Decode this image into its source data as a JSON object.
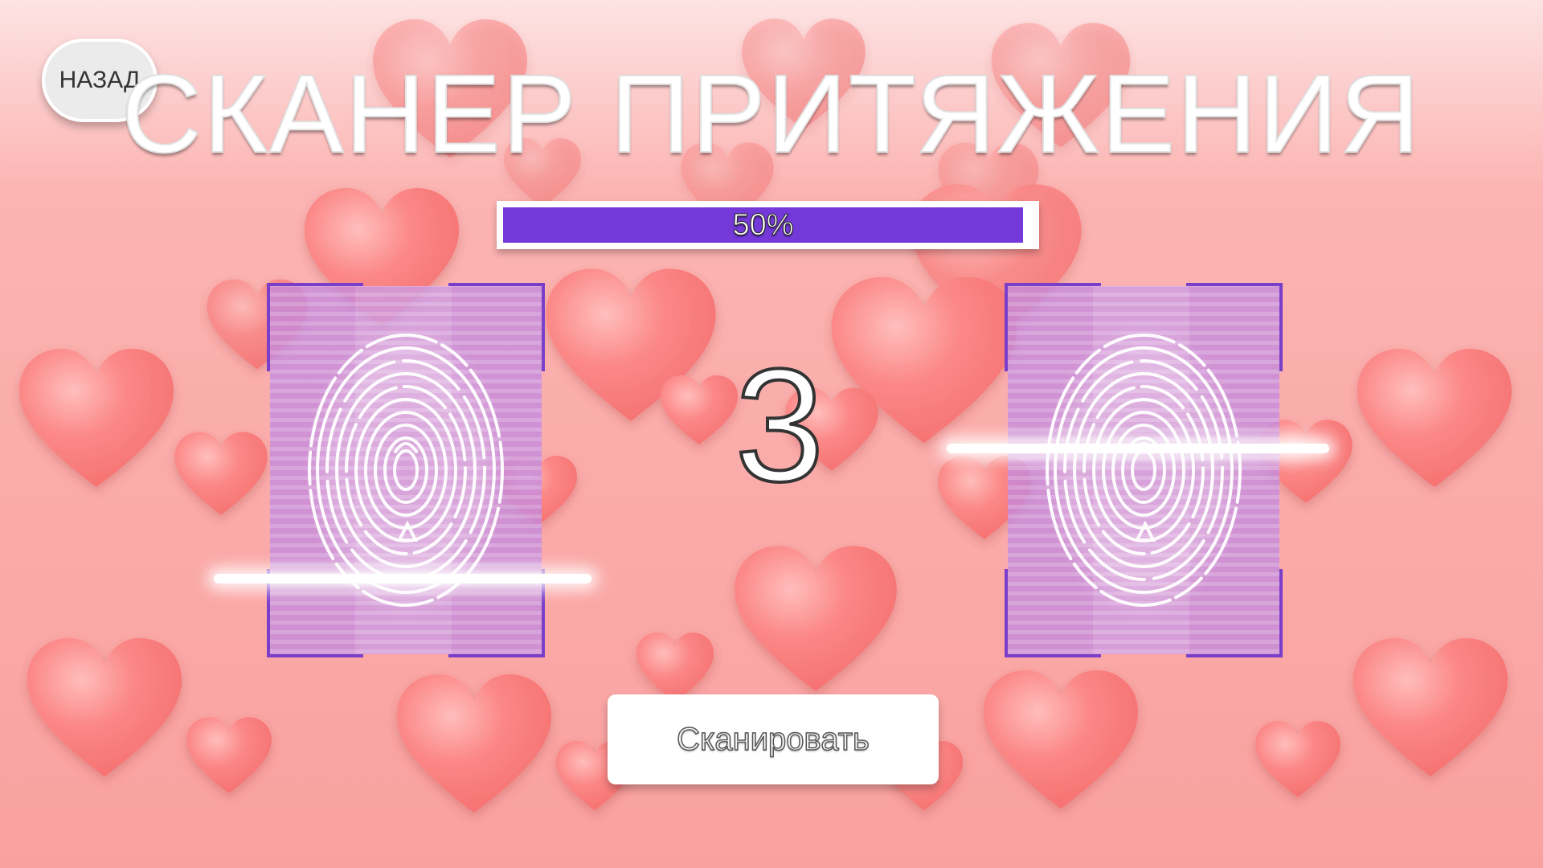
{
  "back_button": {
    "label": "НАЗАД"
  },
  "title": "СКАНЕР ПРИТЯЖЕНИЯ",
  "progress": {
    "value": 0.5,
    "label": "50%",
    "color": "#7539d9"
  },
  "countdown": "3",
  "scan_button": {
    "label": "Сканировать"
  },
  "scanners": [
    {
      "id": "left",
      "scan_level": 0.79
    },
    {
      "id": "right",
      "scan_level": 0.41
    }
  ],
  "colors": {
    "heart": "#fb7c7c",
    "scanner_frame": "#7a3fc9",
    "scanner_fill": "#c48bdf"
  }
}
